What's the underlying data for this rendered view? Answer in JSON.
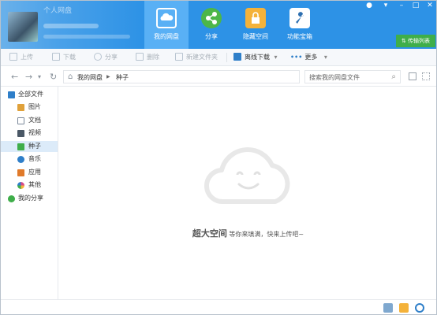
{
  "header": {
    "user_name": "个人网盘",
    "nav": [
      {
        "id": "my-disk",
        "label": "我的网盘",
        "icon": "cloud-disk-icon"
      },
      {
        "id": "share",
        "label": "分享",
        "icon": "share-icon"
      },
      {
        "id": "private",
        "label": "隐藏空间",
        "icon": "lock-icon"
      },
      {
        "id": "toolbox",
        "label": "功能宝箱",
        "icon": "wrench-icon"
      }
    ],
    "transfer_label": "传输列表",
    "colors": {
      "header_bg": "#2d92e6",
      "active_tab": "#59b0f5",
      "transfer_bg": "#3fae4a"
    }
  },
  "toolbar": {
    "upload": "上传",
    "download": "下载",
    "share": "分享",
    "delete": "删除",
    "new_folder": "新建文件夹",
    "offline": "离线下载",
    "more": "更多"
  },
  "address": {
    "crumb_root": "我的网盘",
    "crumb_current": "种子",
    "search_placeholder": "搜索我的网盘文件"
  },
  "sidebar": {
    "items": [
      {
        "label": "全部文件",
        "icon": "folder-icon",
        "color": "#2f7fc9"
      },
      {
        "label": "图片",
        "icon": "image-icon",
        "color": "#e0a13a"
      },
      {
        "label": "文档",
        "icon": "document-icon",
        "color": "#7a8899"
      },
      {
        "label": "视频",
        "icon": "video-icon",
        "color": "#4a5866"
      },
      {
        "label": "种子",
        "icon": "torrent-icon",
        "color": "#3fae4a"
      },
      {
        "label": "音乐",
        "icon": "music-icon",
        "color": "#2f7fc9"
      },
      {
        "label": "应用",
        "icon": "app-icon",
        "color": "#e07a2a"
      },
      {
        "label": "其他",
        "icon": "other-icon",
        "color": "#d94a8a"
      },
      {
        "label": "我的分享",
        "icon": "share-icon",
        "color": "#3fae4a"
      }
    ]
  },
  "main": {
    "empty_title": "超大空间",
    "empty_subtitle": "等你来填满，快来上传吧~"
  }
}
